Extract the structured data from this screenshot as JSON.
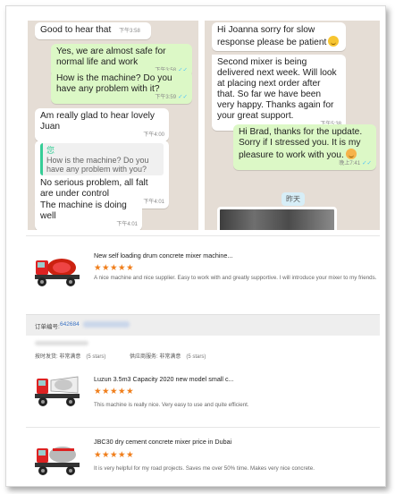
{
  "chat_left": {
    "messages": [
      {
        "dir": "in",
        "text": "Good to hear that",
        "time": "下午3:58"
      },
      {
        "dir": "out",
        "text": "Yes, we are almost safe for normal life and work",
        "time": "下午3:58"
      },
      {
        "dir": "out",
        "text": "How is the machine? Do you have any problem with it?",
        "time": "下午3:59"
      },
      {
        "dir": "in",
        "text": "Am really glad to hear lovely Juan",
        "time": "下午4:00"
      },
      {
        "dir": "in",
        "quote_name": "您",
        "quote_text": "How is the machine? Do you have any problem with you?",
        "text": "No serious problem, all falt are under control",
        "time": "下午4:01"
      },
      {
        "dir": "in",
        "text": "The machine is doing well",
        "time": "下午4:01"
      }
    ]
  },
  "chat_right": {
    "messages": [
      {
        "dir": "in",
        "text": "Hi Joanna sorry for slow response please be patient",
        "time": ""
      },
      {
        "dir": "in",
        "text": "Second mixer is being delivered next week.  Will look at placing next order after that. So far we have been very happy. Thanks again for your great support.",
        "time": "下午5:38"
      },
      {
        "dir": "out",
        "text": "Hi Brad, thanks for the update. Sorry if I stressed you. It is my pleasure to work with you.",
        "time": "晚上7:41"
      }
    ],
    "date_separator": "昨天"
  },
  "reviews": [
    {
      "title": "New self loading drum concrete mixer machine...",
      "stars": "★★★★★",
      "text": "A nice machine and nice supplier. Easy to work with and greatly supportive. I will introduce your mixer to my friends."
    },
    {
      "title": "Luzun 3.5m3 Capacity 2020 new model small c...",
      "stars": "★★★★★",
      "text": "This machine is really nice. Very easy to use and quite efficient."
    },
    {
      "title": "JBC30 dry cement concrete mixer price in Dubai",
      "stars": "★★★★★",
      "text": "It is very helpful for my road projects. Saves me over 50% time. Makes very nice concrete."
    }
  ],
  "order": {
    "label": "订单编号:",
    "number": "642684"
  },
  "ratings": [
    {
      "label": "按时发货: 非常满意",
      "stars": "(5 stars)"
    },
    {
      "label": "供应商服务: 非常满意",
      "stars": "(5 stars)"
    }
  ],
  "colors": {
    "chat_bg": "#e5ddd5",
    "bubble_out": "#dcf8c6",
    "star": "#f07e1b",
    "order_link": "#3b73c4"
  }
}
